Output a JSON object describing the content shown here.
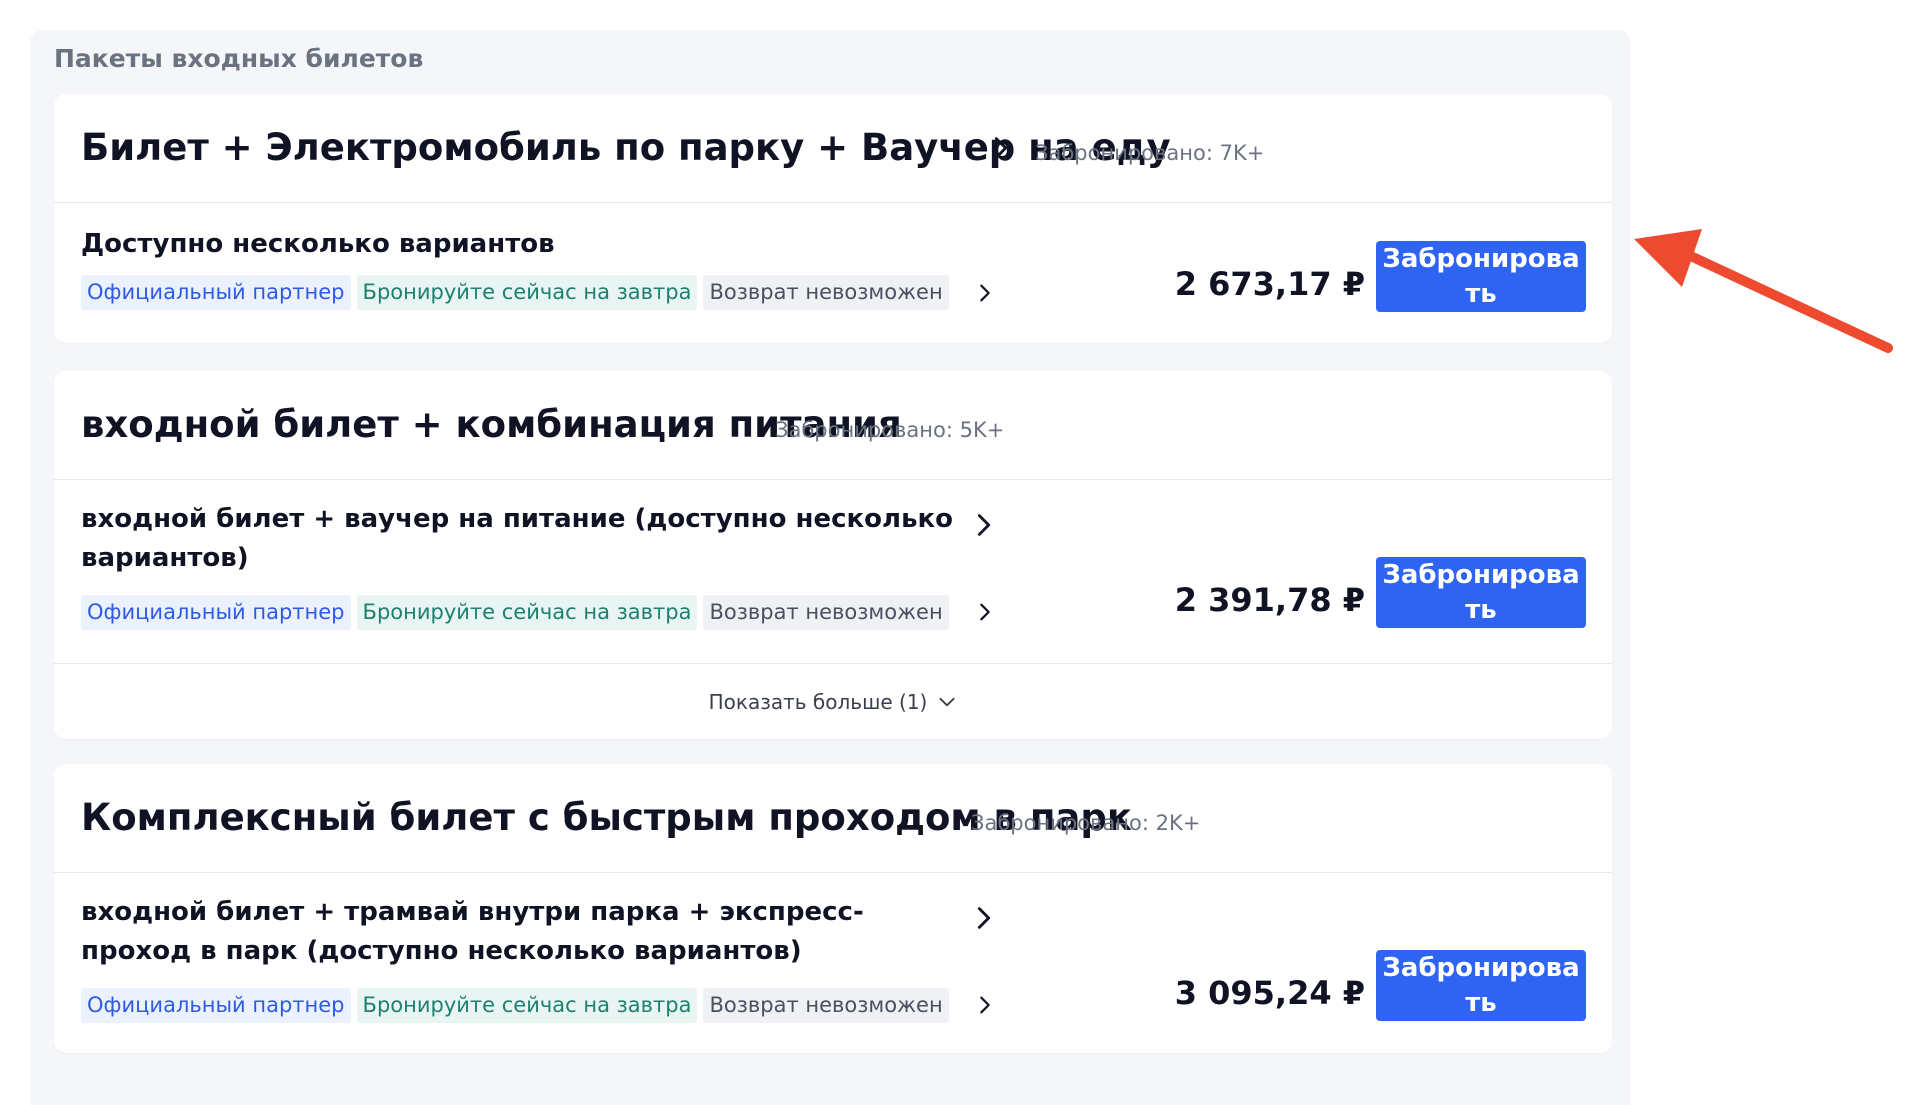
{
  "section": {
    "title": "Пакеты входных билетов"
  },
  "icons": {
    "chevron": "chevron-right-icon",
    "expand": "chevron-down-icon",
    "annotation": "red-arrow-icon"
  },
  "colors": {
    "accent_button": "#2f63f2",
    "partner_tag_text": "#2e5be6",
    "tomorrow_tag_text": "#1f7f70",
    "annotation_arrow": "#ee4a2f"
  },
  "tags": {
    "partner": "Официальный партнер",
    "tomorrow": "Бронируйте сейчас на завтра",
    "refund": "Возврат невозможен"
  },
  "cards": [
    {
      "title": "Билет + Электромобиль по парку + Ваучер на еду",
      "booked": "Забронировано: 7K+",
      "options": [
        {
          "title": "Доступно несколько вариантов",
          "price": "2 673,17 ₽",
          "button": "Забронировать"
        }
      ]
    },
    {
      "title": "входной билет + комбинация питания",
      "booked": "Забронировано: 5K+",
      "options": [
        {
          "title": "входной билет + ваучер на питание (доступно несколько вариантов)",
          "price": "2 391,78 ₽",
          "button": "Забронировать"
        }
      ],
      "show_more": "Показать больше (1)"
    },
    {
      "title": "Комплексный билет с быстрым проходом в парк",
      "booked": "Забронировано: 2K+",
      "options": [
        {
          "title": "входной билет + трамвай внутри парка + экспресс-проход в парк (доступно несколько вариантов)",
          "price": "3 095,24 ₽",
          "button": "Забронировать"
        }
      ]
    }
  ]
}
